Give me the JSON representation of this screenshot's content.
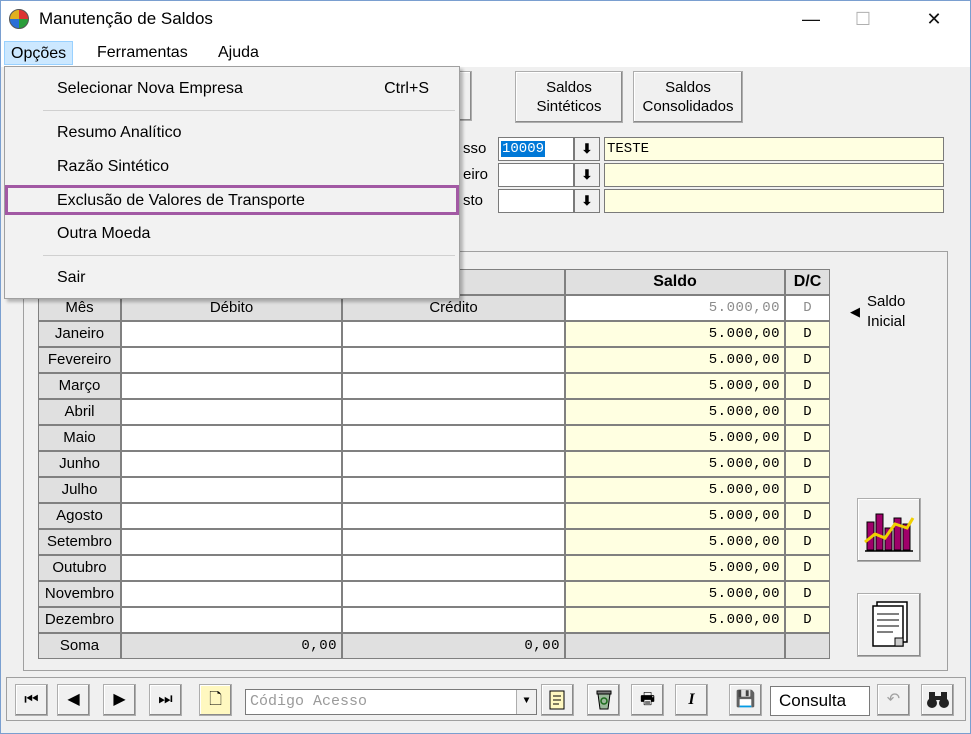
{
  "window": {
    "title": "Manutenção de Saldos",
    "minimize": "—",
    "maximize": "☐",
    "close": "✕"
  },
  "menu": {
    "items": [
      "Opções",
      "Ferramentas",
      "Ajuda"
    ]
  },
  "dropdown": {
    "items": [
      {
        "label": "Selecionar Nova Empresa",
        "shortcut": "Ctrl+S"
      },
      {
        "label": "Resumo Analítico"
      },
      {
        "label": "Razão Sintético"
      },
      {
        "label": "Exclusão de Valores de Transporte"
      },
      {
        "label": "Outra Moeda"
      },
      {
        "label": "Sair"
      }
    ]
  },
  "buttons": {
    "saldos_sinteticos": [
      "Saldos",
      "Sintéticos"
    ],
    "saldos_consolidados": [
      "Saldos",
      "Consolidados"
    ]
  },
  "fields": {
    "row1_label": "sso",
    "row1_value": "10009",
    "row1_desc": "TESTE",
    "row2_label": "eiro",
    "row2_value": "",
    "row2_desc": "",
    "row3_label": "sto",
    "row3_value": "",
    "row3_desc": "",
    "arrow": "⬇"
  },
  "table": {
    "headers": {
      "mes": "Mês",
      "debito": "Débito",
      "credito": "Crédito",
      "saldo": "Saldo",
      "dc": "D/C"
    },
    "initial_row": {
      "saldo": "5.000,00",
      "dc": "D"
    },
    "rows": [
      {
        "mes": "Janeiro",
        "debito": "",
        "credito": "",
        "saldo": "5.000,00",
        "dc": "D"
      },
      {
        "mes": "Fevereiro",
        "debito": "",
        "credito": "",
        "saldo": "5.000,00",
        "dc": "D"
      },
      {
        "mes": "Março",
        "debito": "",
        "credito": "",
        "saldo": "5.000,00",
        "dc": "D"
      },
      {
        "mes": "Abril",
        "debito": "",
        "credito": "",
        "saldo": "5.000,00",
        "dc": "D"
      },
      {
        "mes": "Maio",
        "debito": "",
        "credito": "",
        "saldo": "5.000,00",
        "dc": "D"
      },
      {
        "mes": "Junho",
        "debito": "",
        "credito": "",
        "saldo": "5.000,00",
        "dc": "D"
      },
      {
        "mes": "Julho",
        "debito": "",
        "credito": "",
        "saldo": "5.000,00",
        "dc": "D"
      },
      {
        "mes": "Agosto",
        "debito": "",
        "credito": "",
        "saldo": "5.000,00",
        "dc": "D"
      },
      {
        "mes": "Setembro",
        "debito": "",
        "credito": "",
        "saldo": "5.000,00",
        "dc": "D"
      },
      {
        "mes": "Outubro",
        "debito": "",
        "credito": "",
        "saldo": "5.000,00",
        "dc": "D"
      },
      {
        "mes": "Novembro",
        "debito": "",
        "credito": "",
        "saldo": "5.000,00",
        "dc": "D"
      },
      {
        "mes": "Dezembro",
        "debito": "",
        "credito": "",
        "saldo": "5.000,00",
        "dc": "D"
      }
    ],
    "soma": {
      "label": "Soma",
      "debito": "0,00",
      "credito": "0,00"
    }
  },
  "side": {
    "saldo_inicial": [
      "Saldo",
      "Inicial"
    ],
    "pointer": "◀"
  },
  "toolbar": {
    "first": "⏮",
    "prev": "◀",
    "next": "▶",
    "last": "⏭",
    "new_icon": "🗋",
    "combo_placeholder": "Código Acesso",
    "combo_arrow": "▼",
    "print_icon": "🖶",
    "italic_icon": "I",
    "save_icon": "💾",
    "status": "Consulta",
    "undo_icon": "↶",
    "find_icon": "🔍"
  },
  "colors": {
    "yellow_cell": "#ffffe1",
    "highlight_border": "#a259a4",
    "selection": "#0078d7"
  }
}
